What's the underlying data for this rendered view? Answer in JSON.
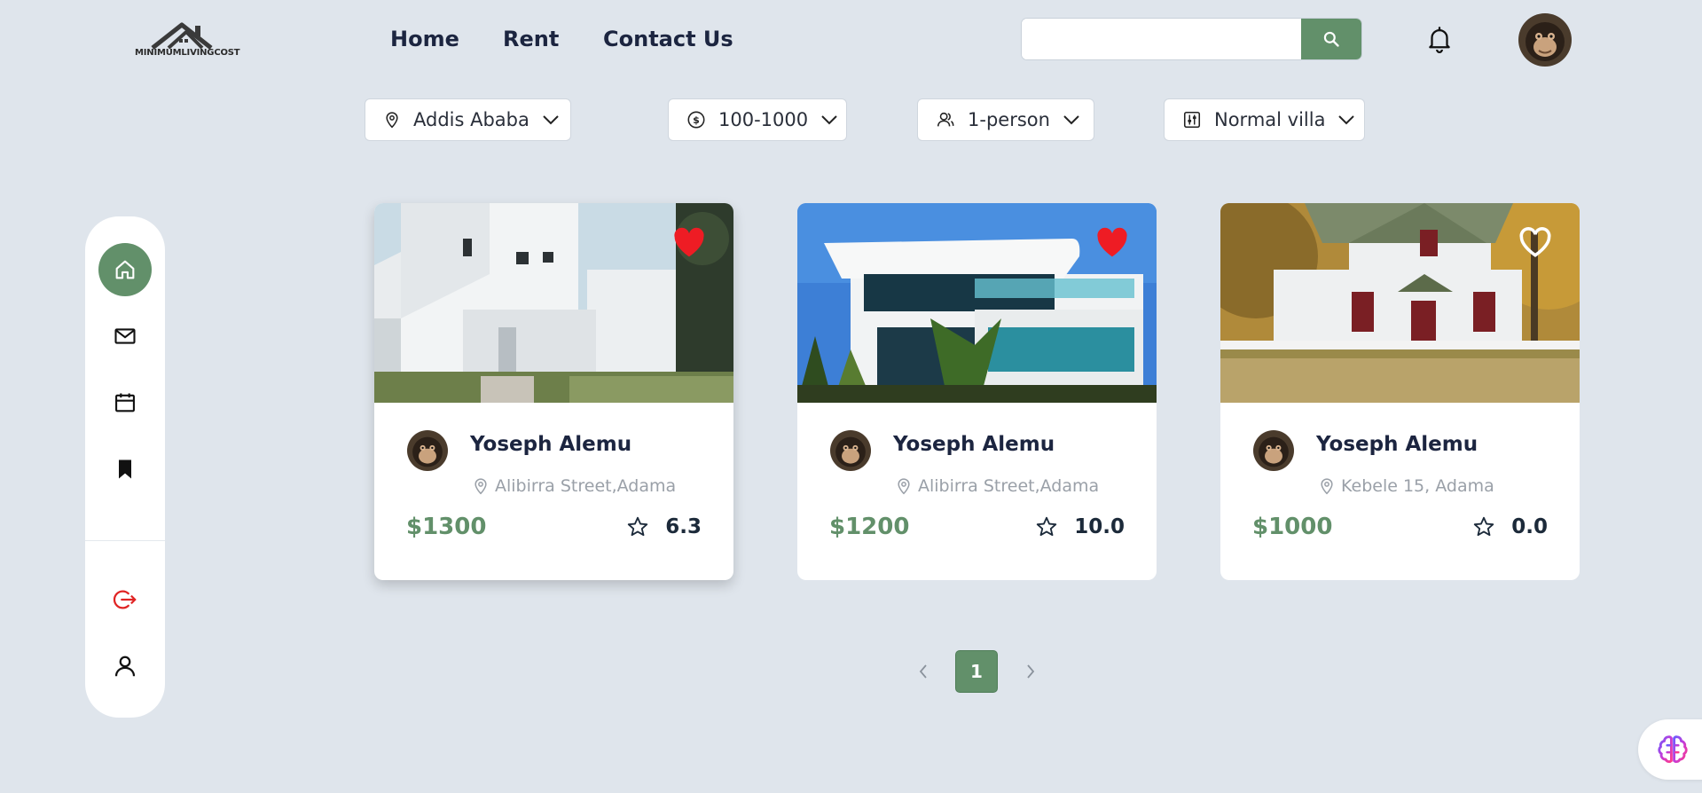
{
  "brand": {
    "logo_text": "MINIMUMLIVINGCOST"
  },
  "nav": {
    "home": "Home",
    "rent": "Rent",
    "contact": "Contact Us"
  },
  "search": {
    "value": "",
    "placeholder": ""
  },
  "filters": {
    "location": "Addis Ababa",
    "price": "100-1000",
    "people": "1-person",
    "type": "Normal villa"
  },
  "listings": [
    {
      "owner": "Yoseph Alemu",
      "location": "Alibirra Street,Adama",
      "price": "$1300",
      "rating": "6.3",
      "favorited": true
    },
    {
      "owner": "Yoseph Alemu",
      "location": "Alibirra Street,Adama",
      "price": "$1200",
      "rating": "10.0",
      "favorited": true
    },
    {
      "owner": "Yoseph Alemu",
      "location": "Kebele 15, Adama",
      "price": "$1000",
      "rating": "0.0",
      "favorited": false
    }
  ],
  "pagination": {
    "current": "1"
  },
  "colors": {
    "accent": "#62906a",
    "heart": "#ee1c24",
    "logout": "#e02424",
    "background": "#dfe5ec"
  }
}
